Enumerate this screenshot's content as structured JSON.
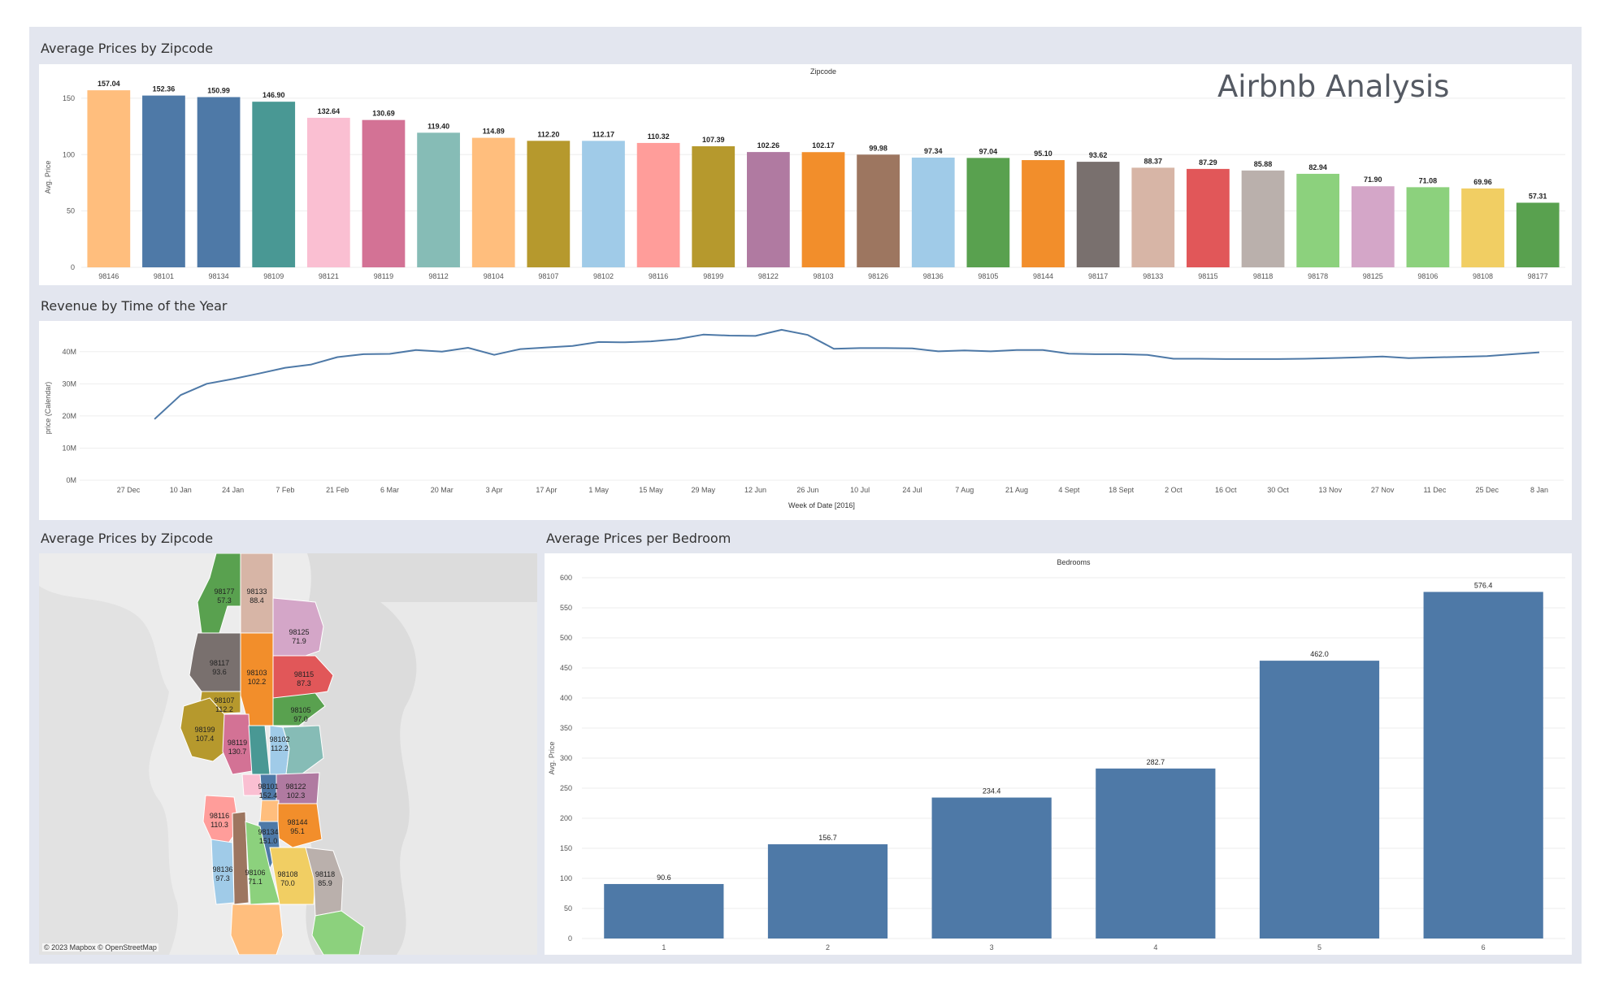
{
  "dashboard": {
    "brand_title": "Airbnb Analysis",
    "sheets": {
      "zip_bar_title": "Average Prices by Zipcode",
      "revenue_title": "Revenue by Time of the Year",
      "map_title": "Average Prices by Zipcode",
      "bedroom_title": "Average Prices per Bedroom"
    },
    "map_attribution": "© 2023 Mapbox © OpenStreetMap"
  },
  "chart_data": [
    {
      "id": "zip_bar",
      "type": "bar",
      "header": "Zipcode",
      "ylabel": "Avg. Price",
      "ylim": [
        0,
        160
      ],
      "yticks": [
        0,
        50,
        100,
        150
      ],
      "grid": true,
      "categories": [
        "98146",
        "98101",
        "98134",
        "98109",
        "98121",
        "98119",
        "98112",
        "98104",
        "98107",
        "98102",
        "98116",
        "98199",
        "98122",
        "98103",
        "98126",
        "98136",
        "98105",
        "98144",
        "98117",
        "98133",
        "98115",
        "98118",
        "98178",
        "98125",
        "98106",
        "98108",
        "98177"
      ],
      "values": [
        157.04,
        152.36,
        150.99,
        146.9,
        132.64,
        130.69,
        119.4,
        114.89,
        112.2,
        112.17,
        110.32,
        107.39,
        102.26,
        102.17,
        99.98,
        97.34,
        97.04,
        95.1,
        93.62,
        88.37,
        87.29,
        85.88,
        82.94,
        71.9,
        71.08,
        69.96,
        57.31
      ],
      "labels": [
        "157.04",
        "152.36",
        "150.99",
        "146.90",
        "132.64",
        "130.69",
        "119.40",
        "114.89",
        "112.20",
        "112.17",
        "110.32",
        "107.39",
        "102.26",
        "102.17",
        "99.98",
        "97.34",
        "97.04",
        "95.10",
        "93.62",
        "88.37",
        "87.29",
        "85.88",
        "82.94",
        "71.90",
        "71.08",
        "69.96",
        "57.31"
      ],
      "colors": [
        "#ffbe7d",
        "#4e79a7",
        "#4e79a7",
        "#499894",
        "#fabfd2",
        "#d37295",
        "#86bcb6",
        "#ffbe7d",
        "#b6992d",
        "#a0cbe8",
        "#ff9d9a",
        "#b6992d",
        "#b07aa1",
        "#f28e2b",
        "#9d7660",
        "#a0cbe8",
        "#59a14f",
        "#f28e2b",
        "#79706e",
        "#d7b5a6",
        "#e15759",
        "#bab0ac",
        "#8cd17d",
        "#d4a6c8",
        "#8cd17d",
        "#f1ce63",
        "#59a14f"
      ]
    },
    {
      "id": "revenue_line",
      "type": "line",
      "ylabel": "price (Calendar)",
      "xlabel": "Week of Date [2016]",
      "ylim": [
        0,
        45
      ],
      "yticks": [
        0,
        10,
        20,
        30,
        40
      ],
      "ytick_labels": [
        "0M",
        "10M",
        "20M",
        "30M",
        "40M"
      ],
      "xtick_labels": [
        "27 Dec",
        "10 Jan",
        "24 Jan",
        "7 Feb",
        "21 Feb",
        "6 Mar",
        "20 Mar",
        "3 Apr",
        "17 Apr",
        "1 May",
        "15 May",
        "29 May",
        "12 Jun",
        "26 Jun",
        "10 Jul",
        "24 Jul",
        "7 Aug",
        "21 Aug",
        "4 Sept",
        "18 Sept",
        "2 Oct",
        "16 Oct",
        "30 Oct",
        "13 Nov",
        "27 Nov",
        "11 Dec",
        "25 Dec",
        "8 Jan"
      ],
      "series": [
        {
          "color": "#4e79a7",
          "x_week": [
            1,
            2,
            3,
            4,
            5,
            6,
            7,
            8,
            9,
            10,
            11,
            12,
            13,
            14,
            15,
            16,
            17,
            18,
            19,
            20,
            21,
            22,
            23,
            24,
            25,
            26,
            27,
            28,
            29,
            30,
            31,
            32,
            33,
            34,
            35,
            36,
            37,
            38,
            39,
            40,
            41,
            42,
            43,
            44,
            45,
            46,
            47,
            48,
            49,
            50,
            51,
            52,
            53,
            54
          ],
          "values": [
            19.0,
            26.5,
            30.0,
            31.5,
            33.2,
            35.0,
            36.0,
            38.3,
            39.2,
            39.3,
            40.5,
            40.0,
            41.2,
            39.0,
            40.8,
            41.3,
            41.8,
            43.0,
            42.9,
            43.2,
            43.9,
            45.3,
            45.0,
            44.9,
            46.8,
            45.2,
            40.9,
            41.1,
            41.1,
            41.0,
            40.1,
            40.4,
            40.1,
            40.5,
            40.5,
            39.4,
            39.2,
            39.2,
            39.0,
            37.8,
            37.8,
            37.7,
            37.7,
            37.7,
            37.8,
            38.0,
            38.2,
            38.5,
            38.0,
            38.2,
            38.4,
            38.6,
            39.2,
            39.8
          ]
        }
      ]
    },
    {
      "id": "bedroom_bar",
      "type": "bar",
      "header": "Bedrooms",
      "ylabel": "Avg. Price",
      "ylim": [
        0,
        600
      ],
      "yticks": [
        0,
        50,
        100,
        150,
        200,
        250,
        300,
        350,
        400,
        450,
        500,
        550,
        600
      ],
      "grid": true,
      "categories": [
        "1",
        "2",
        "3",
        "4",
        "5",
        "6"
      ],
      "values": [
        90.6,
        156.7,
        234.4,
        282.7,
        462.0,
        576.4
      ],
      "labels": [
        "90.6",
        "156.7",
        "234.4",
        "282.7",
        "462.0",
        "576.4"
      ],
      "color": "#4e79a7"
    }
  ],
  "map": {
    "regions": [
      {
        "zip": "98177",
        "value": "57.3",
        "color": "#59a14f"
      },
      {
        "zip": "98133",
        "value": "88.4",
        "color": "#d7b5a6"
      },
      {
        "zip": "98125",
        "value": "71.9",
        "color": "#d4a6c8"
      },
      {
        "zip": "98117",
        "value": "93.6",
        "color": "#79706e"
      },
      {
        "zip": "98103",
        "value": "102.2",
        "color": "#f28e2b"
      },
      {
        "zip": "98115",
        "value": "87.3",
        "color": "#e15759"
      },
      {
        "zip": "98107",
        "value": "112.2",
        "color": "#b6992d"
      },
      {
        "zip": "98105",
        "value": "97.0",
        "color": "#59a14f"
      },
      {
        "zip": "98199",
        "value": "107.4",
        "color": "#b6992d"
      },
      {
        "zip": "98119",
        "value": "130.7",
        "color": "#d37295"
      },
      {
        "zip": "98109",
        "value": "146.9",
        "color": "#499894"
      },
      {
        "zip": "98102",
        "value": "112.2",
        "color": "#a0cbe8"
      },
      {
        "zip": "98112",
        "value": "119.4",
        "color": "#86bcb6"
      },
      {
        "zip": "98101",
        "value": "152.4",
        "color": "#4e79a7"
      },
      {
        "zip": "98121",
        "value": "132.6",
        "color": "#fabfd2"
      },
      {
        "zip": "98122",
        "value": "102.3",
        "color": "#b07aa1"
      },
      {
        "zip": "98104",
        "value": "114.9",
        "color": "#ffbe7d"
      },
      {
        "zip": "98144",
        "value": "95.1",
        "color": "#f28e2b"
      },
      {
        "zip": "98134",
        "value": "151.0",
        "color": "#4e79a7"
      },
      {
        "zip": "98116",
        "value": "110.3",
        "color": "#ff9d9a"
      },
      {
        "zip": "98126",
        "value": "100.0",
        "color": "#9d7660"
      },
      {
        "zip": "98136",
        "value": "97.3",
        "color": "#a0cbe8"
      },
      {
        "zip": "98106",
        "value": "71.1",
        "color": "#8cd17d"
      },
      {
        "zip": "98108",
        "value": "70.0",
        "color": "#f1ce63"
      },
      {
        "zip": "98118",
        "value": "85.9",
        "color": "#bab0ac"
      },
      {
        "zip": "98178",
        "value": "82.9",
        "color": "#8cd17d"
      },
      {
        "zip": "98146",
        "value": "157.0",
        "color": "#ffbe7d"
      }
    ]
  }
}
